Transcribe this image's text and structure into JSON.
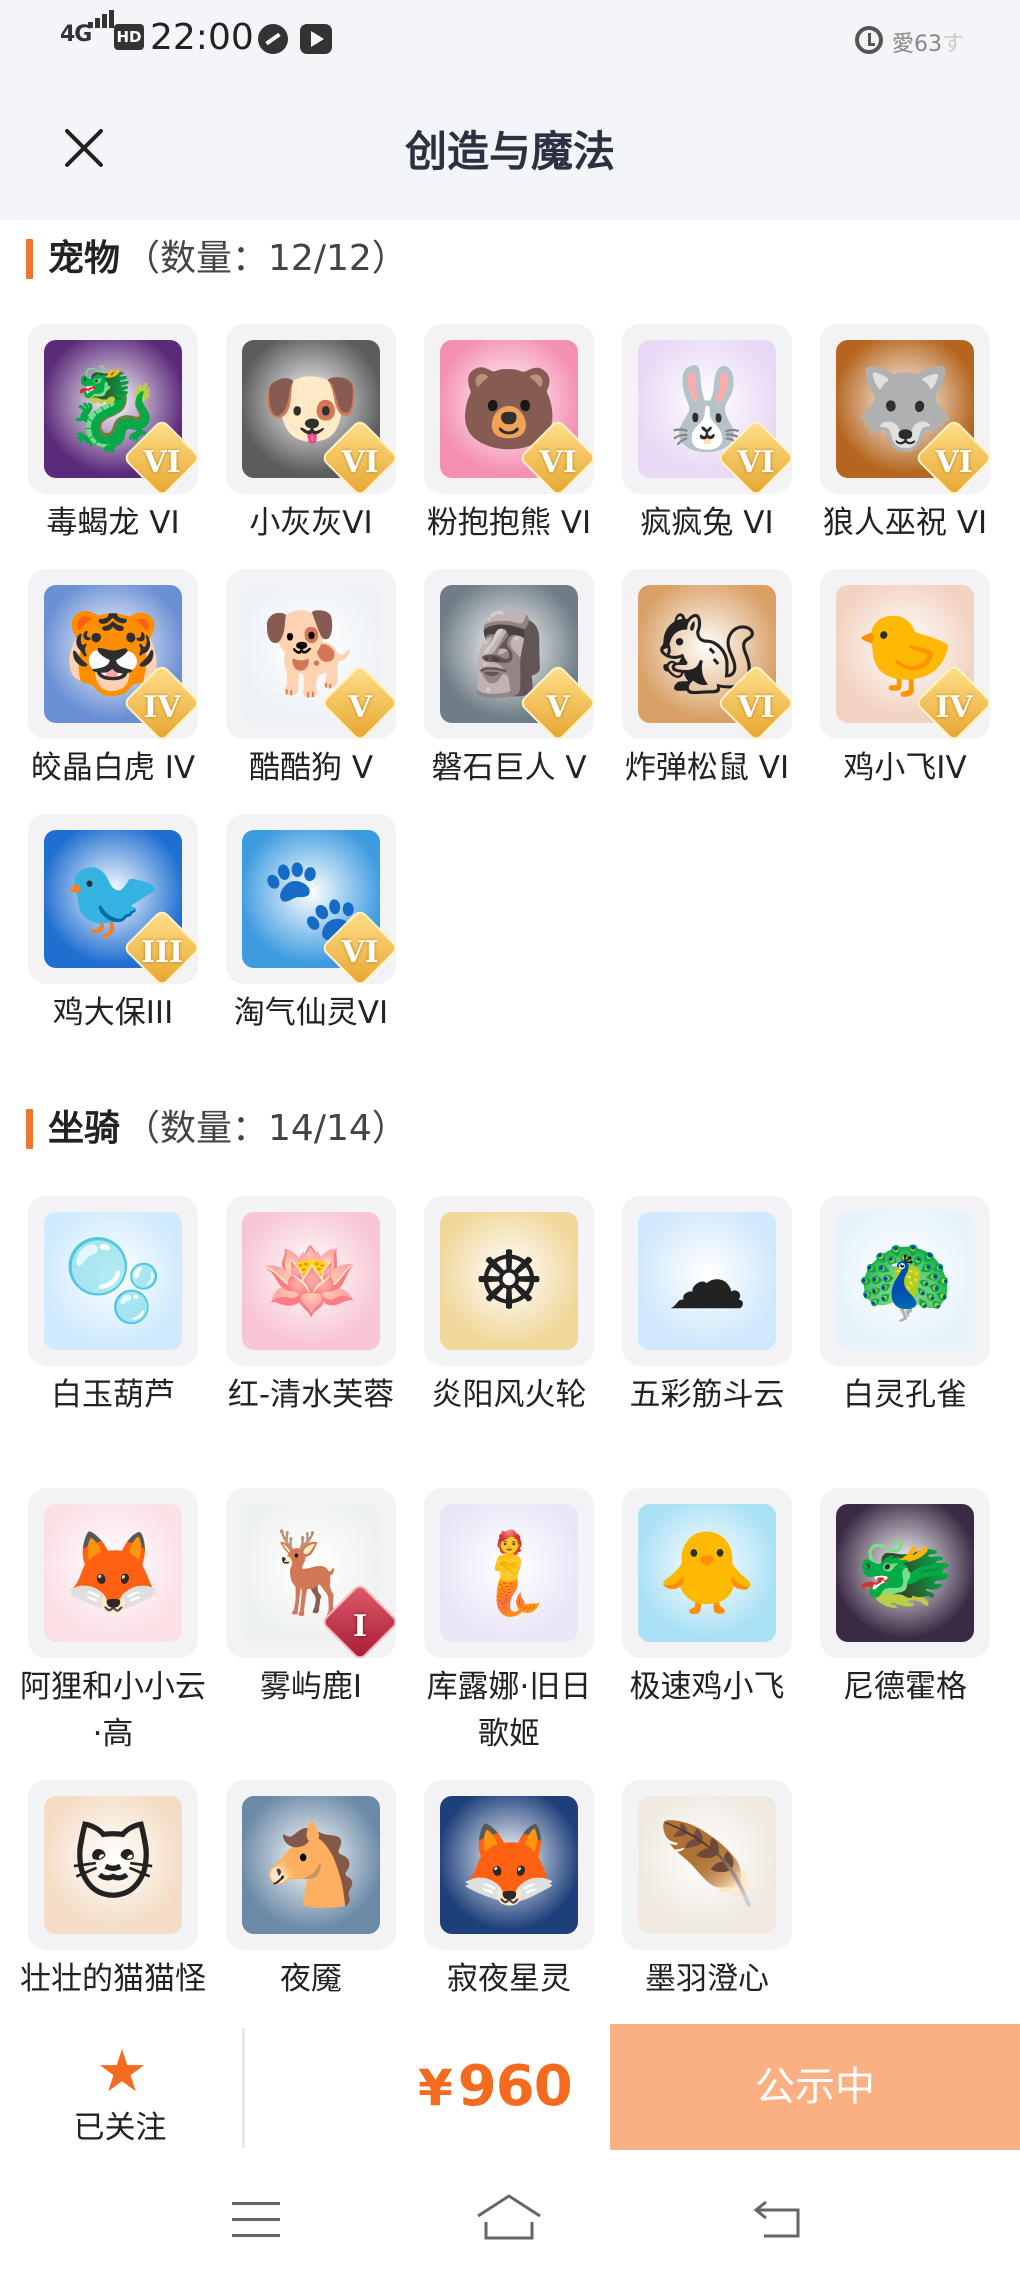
{
  "status_bar": {
    "network": "4G",
    "hd": "HD",
    "time": "22:00",
    "right_text": "愛",
    "right_text_2": "63",
    "right_text_faint": "す"
  },
  "header": {
    "title": "创造与魔法"
  },
  "pets": {
    "name": "宠物",
    "count": "（数量：12/12）",
    "items": [
      {
        "name": "毒蝎龙 VI",
        "badge": "VI",
        "color": "#5b2a7a",
        "glyph": "🐉"
      },
      {
        "name": "小灰灰VI",
        "badge": "VI",
        "color": "#5c5c5c",
        "glyph": "🐶"
      },
      {
        "name": "粉抱抱熊 VI",
        "badge": "VI",
        "color": "#f48fb1",
        "glyph": "🐻"
      },
      {
        "name": "疯疯兔 VI",
        "badge": "VI",
        "color": "#e9d8f5",
        "glyph": "🐰"
      },
      {
        "name": "狼人巫祝 VI",
        "badge": "VI",
        "color": "#b5651d",
        "glyph": "🐺"
      },
      {
        "name": "皎晶白虎 IV",
        "badge": "IV",
        "color": "#6a8fd4",
        "glyph": "🐯"
      },
      {
        "name": "酷酷狗 V",
        "badge": "V",
        "color": "#eef2f7",
        "glyph": "🐕"
      },
      {
        "name": "磐石巨人 V",
        "badge": "V",
        "color": "#6f7d86",
        "glyph": "🗿"
      },
      {
        "name": "炸弹松鼠 VI",
        "badge": "VI",
        "color": "#d9a066",
        "glyph": "🐿"
      },
      {
        "name": "鸡小飞IV",
        "badge": "IV",
        "color": "#f2d2c0",
        "glyph": "🐤"
      },
      {
        "name": "鸡大保III",
        "badge": "III",
        "color": "#1f6fd1",
        "glyph": "🐦"
      },
      {
        "name": "淘气仙灵VI",
        "badge": "VI",
        "color": "#3d9be0",
        "glyph": "🐾"
      }
    ]
  },
  "mounts": {
    "name": "坐骑",
    "count": "（数量：14/14）",
    "items": [
      {
        "name": "白玉葫芦",
        "color": "#cfeafc",
        "glyph": "🫧"
      },
      {
        "name": "红-清水芙蓉",
        "color": "#f7c5d3",
        "glyph": "🪷"
      },
      {
        "name": "炎阳风火轮",
        "color": "#f0d79a",
        "glyph": "☸"
      },
      {
        "name": "五彩筋斗云",
        "color": "#cfe8fb",
        "glyph": "☁"
      },
      {
        "name": "白灵孔雀",
        "color": "#e6f3fb",
        "glyph": "🦚"
      },
      {
        "name": "阿狸和小小云·高",
        "color": "#fbe0e6",
        "glyph": "🦊"
      },
      {
        "name": "雾屿鹿I",
        "badge": "I",
        "color": "#eef2ee",
        "glyph": "🦌"
      },
      {
        "name": "库露娜·旧日歌姬",
        "color": "#eae6f7",
        "glyph": "🧜"
      },
      {
        "name": "极速鸡小飞",
        "color": "#a9e0f5",
        "glyph": "🐥"
      },
      {
        "name": "尼德霍格",
        "color": "#3a2a44",
        "glyph": "🐲"
      },
      {
        "name": "壮壮的猫猫怪",
        "color": "#f4dcc4",
        "glyph": "🐱"
      },
      {
        "name": "夜魇",
        "color": "#6b8aa6",
        "glyph": "🐴"
      },
      {
        "name": "寂夜星灵",
        "color": "#1d3f7a",
        "glyph": "🦊"
      },
      {
        "name": "墨羽澄心",
        "color": "#efe9df",
        "glyph": "🪶"
      }
    ]
  },
  "bottom": {
    "follow_label": "已关注",
    "price_symbol": "¥",
    "price": "960",
    "status_button": "公示中"
  }
}
